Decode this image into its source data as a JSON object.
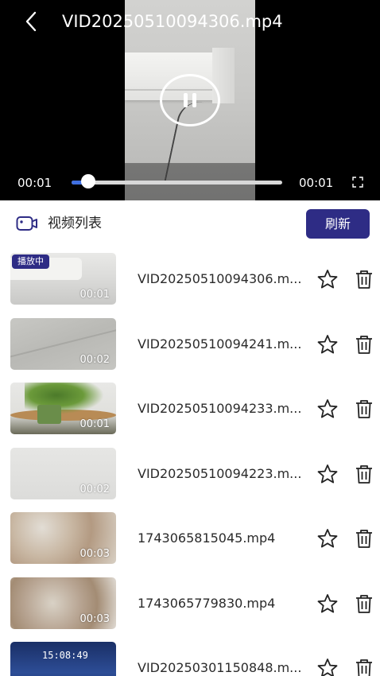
{
  "player": {
    "title": "VID20250510094306.mp4",
    "current_time": "00:01",
    "duration": "00:01",
    "progress": 0.08,
    "state": "playing"
  },
  "list": {
    "title": "视频列表",
    "refresh_label": "刷新"
  },
  "videos": [
    {
      "name": "VID20250510094306.m...",
      "duration": "00:01",
      "badge": "播放中"
    },
    {
      "name": "VID20250510094241.m...",
      "duration": "00:02"
    },
    {
      "name": "VID20250510094233.m...",
      "duration": "00:01"
    },
    {
      "name": "VID20250510094223.m...",
      "duration": "00:02"
    },
    {
      "name": "1743065815045.mp4",
      "duration": "00:03"
    },
    {
      "name": "1743065779830.mp4",
      "duration": "00:03"
    },
    {
      "name": "VID20250301150848.m...",
      "thumb_text": "15:08:49"
    }
  ],
  "colors": {
    "accent": "#2e2c85",
    "seek_fill": "#3f6fe0"
  }
}
